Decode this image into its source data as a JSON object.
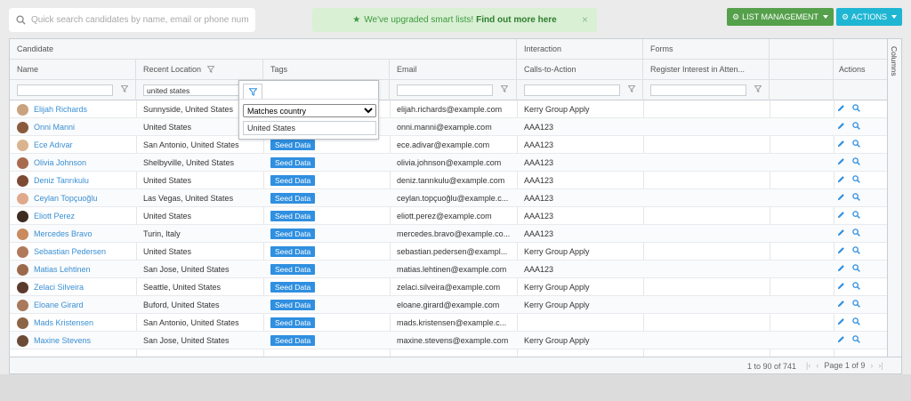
{
  "search": {
    "placeholder": "Quick search candidates by name, email or phone number",
    "icon": "search-icon"
  },
  "banner": {
    "text": "We've upgraded smart lists!",
    "link": "Find out more here",
    "close": "×",
    "color": "#d9f0d5"
  },
  "toolbar": {
    "list_management_label": "LIST MANAGEMENT",
    "actions_label": "ACTIONS",
    "list_color": "#55a04b",
    "actions_color": "#1fb6d3"
  },
  "groups": {
    "candidate": "Candidate",
    "interaction": "Interaction",
    "forms": "Forms"
  },
  "columns": {
    "name": "Name",
    "location": "Recent Location",
    "tags": "Tags",
    "email": "Email",
    "cta": "Calls-to-Action",
    "register": "Register Interest in Atten...",
    "actions": "Actions"
  },
  "filters": {
    "location_value": "united states"
  },
  "popup": {
    "condition": "Matches country",
    "value": "United States"
  },
  "sidebar": {
    "columns_label": "Columns"
  },
  "rows": [
    {
      "name": "Elijah Richards",
      "location": "Sunnyside, United States",
      "tag": "",
      "email": "elijah.richards@example.com",
      "cta": "Kerry Group Apply"
    },
    {
      "name": "Onni Manni",
      "location": "United States",
      "tag": "",
      "email": "onni.manni@example.com",
      "cta": "AAA123"
    },
    {
      "name": "Ece Adıvar",
      "location": "San Antonio, United States",
      "tag": "Seed Data",
      "email": "ece.adivar@example.com",
      "cta": "AAA123"
    },
    {
      "name": "Olivia Johnson",
      "location": "Shelbyville, United States",
      "tag": "Seed Data",
      "email": "olivia.johnson@example.com",
      "cta": "AAA123"
    },
    {
      "name": "Deniz Tanrıkulu",
      "location": "United States",
      "tag": "Seed Data",
      "email": "deniz.tanrıkulu@example.com",
      "cta": "AAA123"
    },
    {
      "name": "Ceylan Topçuoğlu",
      "location": "Las Vegas, United States",
      "tag": "Seed Data",
      "email": "ceylan.topçuoğlu@example.c...",
      "cta": "AAA123"
    },
    {
      "name": "Eliott Perez",
      "location": "United States",
      "tag": "Seed Data",
      "email": "eliott.perez@example.com",
      "cta": "AAA123"
    },
    {
      "name": "Mercedes Bravo",
      "location": "Turin, Italy",
      "tag": "Seed Data",
      "email": "mercedes.bravo@example.co...",
      "cta": "AAA123"
    },
    {
      "name": "Sebastian Pedersen",
      "location": "United States",
      "tag": "Seed Data",
      "email": "sebastian.pedersen@exampl...",
      "cta": "Kerry Group Apply"
    },
    {
      "name": "Matias Lehtinen",
      "location": "San Jose, United States",
      "tag": "Seed Data",
      "email": "matias.lehtinen@example.com",
      "cta": "AAA123"
    },
    {
      "name": "Zelaci Silveira",
      "location": "Seattle, United States",
      "tag": "Seed Data",
      "email": "zelaci.silveira@example.com",
      "cta": "Kerry Group Apply"
    },
    {
      "name": "Eloane Girard",
      "location": "Buford, United States",
      "tag": "Seed Data",
      "email": "eloane.girard@example.com",
      "cta": "Kerry Group Apply"
    },
    {
      "name": "Mads Kristensen",
      "location": "San Antonio, United States",
      "tag": "Seed Data",
      "email": "mads.kristensen@example.c...",
      "cta": ""
    },
    {
      "name": "Maxine Stevens",
      "location": "San Jose, United States",
      "tag": "Seed Data",
      "email": "maxine.stevens@example.com",
      "cta": "Kerry Group Apply"
    }
  ],
  "avatar_colors": [
    "#c9a27e",
    "#8a5a3c",
    "#d9b48f",
    "#a86b4f",
    "#7d4a33",
    "#e0a98b",
    "#3d2b22",
    "#c98a5e",
    "#b07a5a",
    "#9a6a4a",
    "#5a3a2a",
    "#a8795a",
    "#8c6446",
    "#6b4a36"
  ],
  "footer": {
    "count": "1 to 90 of 741",
    "page": "Page 1 of 9"
  },
  "accent": "#3a8fd3"
}
